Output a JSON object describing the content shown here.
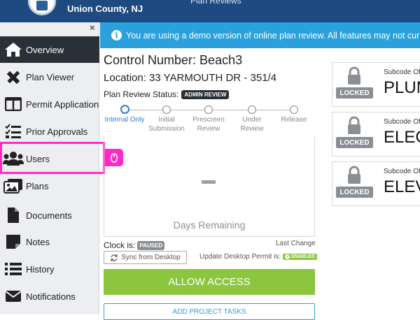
{
  "header": {
    "county": "Union County, NJ",
    "title": "Plan Reviews"
  },
  "sidebar": {
    "close": "×",
    "items": [
      {
        "label": "Overview",
        "icon": "home-icon"
      },
      {
        "label": "Plan Viewer",
        "icon": "pencil-ruler-icon"
      },
      {
        "label": "Permit Application",
        "icon": "columns-icon"
      },
      {
        "label": "Prior Approvals",
        "icon": "checklist-icon"
      },
      {
        "label": "Users",
        "icon": "users-icon"
      },
      {
        "label": "Plans",
        "icon": "images-icon"
      },
      {
        "label": "Documents",
        "icon": "file-icon"
      },
      {
        "label": "Notes",
        "icon": "note-icon"
      },
      {
        "label": "History",
        "icon": "list-icon"
      },
      {
        "label": "Notifications",
        "icon": "envelope-icon"
      }
    ]
  },
  "banner": {
    "text": "You are using a demo version of online plan review. All features may not currently be available."
  },
  "review": {
    "control": "Control Number: Beach3",
    "location": "Location: 33 YARMOUTH DR - 351/4",
    "status_label": "Plan Review Status:",
    "status_badge": "ADMIN REVIEW"
  },
  "steps": [
    {
      "label": "Internal Only",
      "current": true
    },
    {
      "label": "Initial Submission",
      "current": false
    },
    {
      "label": "Prescreen Review",
      "current": false
    },
    {
      "label": "Under Review",
      "current": false
    },
    {
      "label": "Release",
      "current": false
    }
  ],
  "timer": {
    "value": "-",
    "label": "Days Remaining"
  },
  "clock": {
    "label": "Clock is:",
    "badge": "PAUSED",
    "last_change": "Last Change",
    "sync_label": "Sync from Desktop",
    "update_label": "Update Desktop Permit is:",
    "update_badge": "ENABLED"
  },
  "actions": {
    "allow": "ALLOW ACCESS",
    "tasks": "ADD PROJECT TASKS"
  },
  "subcodes": [
    {
      "title": "Subcode Official",
      "name": "PLUMBING",
      "locked": "LOCKED"
    },
    {
      "title": "Subcode Official",
      "name": "ELECTRICAL",
      "locked": "LOCKED"
    },
    {
      "title": "Subcode Official",
      "name": "ELEVATOR",
      "locked": "LOCKED"
    }
  ],
  "colors": {
    "header": "#1d4a80",
    "banner": "#2aa1dc",
    "success": "#8cc63f",
    "active_nav": "#2a3037",
    "highlight": "#ff2bc8"
  }
}
